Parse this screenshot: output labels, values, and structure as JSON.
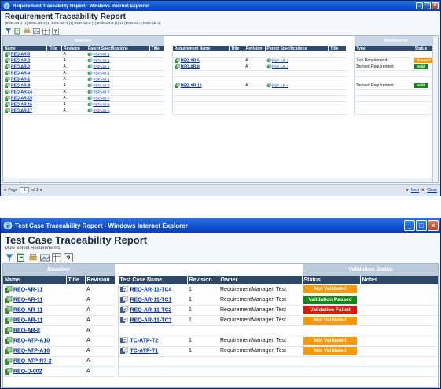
{
  "window1": {
    "title": "Requirement Traceability Report - Windows Internet Explorer",
    "report_title": "Requirement Traceability Report",
    "report_subtitle": "(RSP-AR-1 (1),RSP-AR-3 (1),RSP-AR-7 (1),RSP-AR-8 (1),RSP-AR-9 (1) vs (RSP-AR-2,RSP-AR-4)",
    "groups": {
      "baseline": "Baseline",
      "relationship": "Relationship"
    },
    "columns": {
      "name": "Name",
      "title": "Title",
      "revision": "Revision",
      "parent_specs": "Parent Specifications",
      "title2": "Title",
      "req_name": "Requirement Name",
      "title3": "Title",
      "revision2": "Revision",
      "parent_specs2": "Parent Specifications",
      "title4": "Title",
      "type": "Type",
      "status": "Status"
    },
    "rows": [
      {
        "name": "REQ-AR-3",
        "rev": "A",
        "spec": "RSP-AR-1",
        "rname": "",
        "rrev": "",
        "rspec": "",
        "type": "",
        "status": ""
      },
      {
        "name": "REQ-AR-2",
        "rev": "A",
        "spec": "RSP-AR-1",
        "rname": "REQ-AR-5",
        "rrev": "A",
        "rspec": "RSP-AR-2",
        "type": "Sub Requirement",
        "status": "Suspect"
      },
      {
        "name": "REQ-AR-2",
        "rev": "A",
        "spec": "RSP-AR-1",
        "rname": "REQ-AR-8",
        "rrev": "A",
        "rspec": "RSP-AR-2",
        "type": "Derived Requirement",
        "status": "Valid"
      },
      {
        "name": "REQ-AR-4",
        "rev": "A",
        "spec": "RSP-AR-1",
        "rname": "",
        "rrev": "",
        "rspec": "",
        "type": "",
        "status": ""
      },
      {
        "name": "REQ-AR-1",
        "rev": "A",
        "spec": "RSP-AR-1",
        "rname": "",
        "rrev": "",
        "rspec": "",
        "type": "",
        "status": ""
      },
      {
        "name": "REQ-AR-9",
        "rev": "A",
        "spec": "RSP-AR-3",
        "rname": "REQ-AR-10",
        "rrev": "A",
        "rspec": "RSP-AR-4",
        "type": "Derived Requirement",
        "status": "Valid"
      },
      {
        "name": "REQ-AR-14",
        "rev": "A",
        "spec": "RSP-AR-7",
        "rname": "",
        "rrev": "",
        "rspec": "",
        "type": "",
        "status": ""
      },
      {
        "name": "REQ-AR-15",
        "rev": "A",
        "spec": "RSP-AR-7",
        "rname": "",
        "rrev": "",
        "rspec": "",
        "type": "",
        "status": ""
      },
      {
        "name": "REQ-AR-16",
        "rev": "A",
        "spec": "RSP-AR-8",
        "rname": "",
        "rrev": "",
        "rspec": "",
        "type": "",
        "status": ""
      },
      {
        "name": "REQ-AR-17",
        "rev": "A",
        "spec": "RSP-AR-9",
        "rname": "",
        "rrev": "",
        "rspec": "",
        "type": "",
        "status": ""
      }
    ],
    "pager": {
      "page_label": "Page",
      "page_value": "1",
      "of_label": "of 1",
      "next": "Next",
      "close": "Close"
    }
  },
  "window2": {
    "title": "Test Case Traceability Report - Windows Internet Explorer",
    "report_title": "Test Case Traceability Report",
    "report_subtitle": "Multi-Select Requirements",
    "groups": {
      "baseline": "Baseline",
      "validation": "Validation Status"
    },
    "columns": {
      "name": "Name",
      "title": "Title",
      "revision": "Revision",
      "tc_name": "Test Case Name",
      "tc_revision": "Revision",
      "owner": "Owner",
      "status": "Status",
      "notes": "Notes"
    },
    "rows": [
      {
        "name": "REQ-AR-11",
        "rev": "A",
        "tc": "REQ-AR-11-TC4",
        "tcrev": "1",
        "owner": "RequirementManager, Test",
        "status": "Not Validated"
      },
      {
        "name": "REQ-AR-11",
        "rev": "A",
        "tc": "REQ-AR-11-TC1",
        "tcrev": "1",
        "owner": "RequirementManager, Test",
        "status": "Validation Passed"
      },
      {
        "name": "REQ-AR-11",
        "rev": "A",
        "tc": "REQ-AR-11-TC2",
        "tcrev": "1",
        "owner": "RequirementManager, Test",
        "status": "Validation Failed"
      },
      {
        "name": "REQ-AR-11",
        "rev": "A",
        "tc": "REQ-AR-11-TC3",
        "tcrev": "1",
        "owner": "RequirementManager, Test",
        "status": "Not Validated"
      },
      {
        "name": "REQ-AR-8",
        "rev": "A",
        "tc": "",
        "tcrev": "",
        "owner": "",
        "status": ""
      },
      {
        "name": "REQ-ATP-A10",
        "rev": "A",
        "tc": "TC-ATP-T2",
        "tcrev": "1",
        "owner": "RequirementManager, Test",
        "status": "Not Validated"
      },
      {
        "name": "REQ-ATP-A10",
        "rev": "A",
        "tc": "TC-ATP-T1",
        "tcrev": "1",
        "owner": "RequirementManager, Test",
        "status": "Not Validated"
      },
      {
        "name": "REQ-ATP-R7-3",
        "rev": "A",
        "tc": "",
        "tcrev": "",
        "owner": "",
        "status": ""
      },
      {
        "name": "REQ-D-002",
        "rev": "A",
        "tc": "",
        "tcrev": "",
        "owner": "",
        "status": ""
      }
    ]
  },
  "colors": {
    "suspect": "#ff9900",
    "valid": "#118811",
    "not_validated": "#ff9900",
    "passed": "#118811",
    "failed": "#e3150c",
    "header": "#2f4a6e",
    "titlebar": "#0d4fd0"
  },
  "icons": [
    "ie-icon",
    "minimize-icon",
    "maximize-icon",
    "close-icon",
    "requirement-icon",
    "specification-icon",
    "test-case-icon",
    "toolbar-icons"
  ]
}
